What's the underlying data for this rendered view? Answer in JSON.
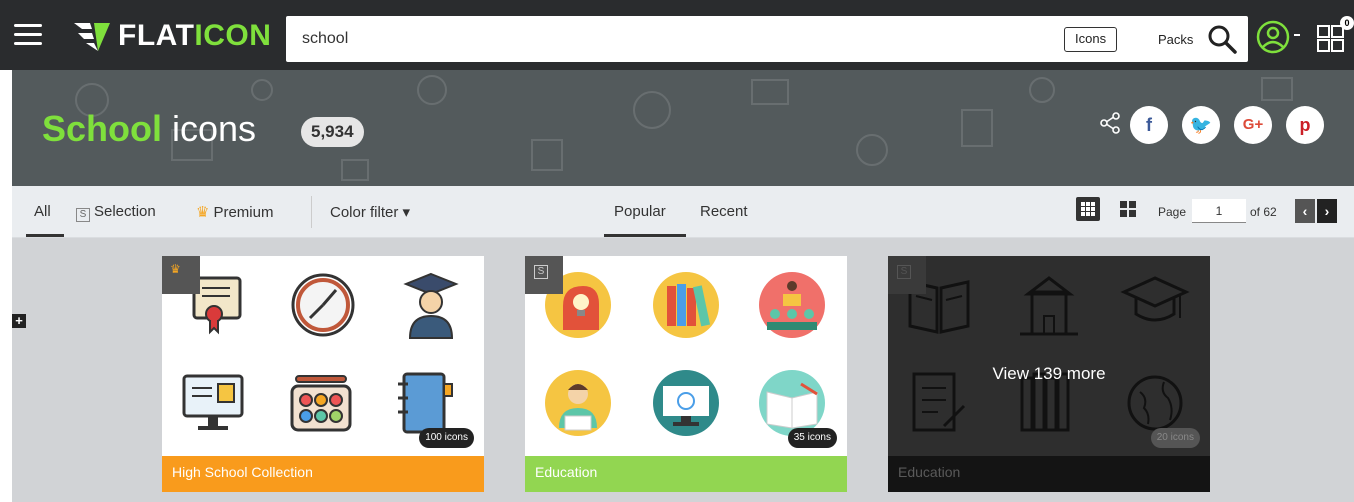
{
  "header": {
    "menu_icon": "hamburger-icon",
    "logo_text_prefix": "FLAT",
    "logo_text_suffix": "ICON",
    "search_value": "school",
    "scope_icons_label": "Icons",
    "scope_packs_label": "Packs",
    "search_icon": "search-icon",
    "user_icon": "user-icon",
    "apps_icon": "apps-icon",
    "apps_badge": "0"
  },
  "hero": {
    "keyword": "School",
    "title_suffix": " icons",
    "count": "5,934",
    "social": [
      "f",
      "🐦",
      "G+",
      "p"
    ]
  },
  "filters": {
    "all": "All",
    "selection_badge": "S",
    "selection": "Selection",
    "premium": "Premium",
    "color_filter": "Color filter ▾",
    "popular": "Popular",
    "recent": "Recent",
    "page_label": "Page",
    "page_value": "1",
    "page_of": "of 62",
    "prev": "‹",
    "next": "›"
  },
  "side_toggle": "+",
  "cards": [
    {
      "title": "High School Collection",
      "count": "100 icons",
      "badge": "♛",
      "color": "#f99b1c"
    },
    {
      "title": "Education",
      "count": "35 icons",
      "badge": "S",
      "color": "#92d651"
    },
    {
      "title": "Education",
      "count": "20 icons",
      "badge": "S",
      "overlay": "View 139 more",
      "color": "#141414"
    }
  ],
  "colors": {
    "accent": "#7fe03c",
    "dark": "#2a2c2e",
    "hero": "#535a5c"
  }
}
